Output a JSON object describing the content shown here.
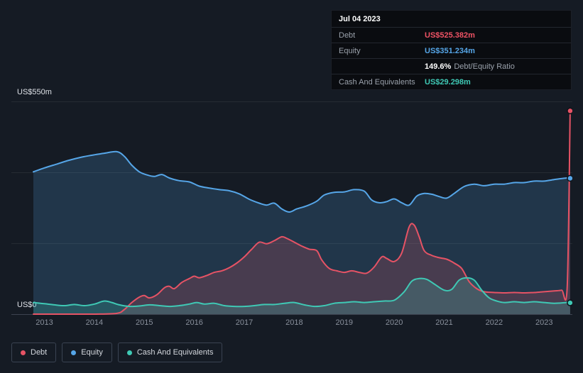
{
  "tooltip": {
    "date": "Jul 04 2023",
    "debt_label": "Debt",
    "debt_value": "US$525.382m",
    "equity_label": "Equity",
    "equity_value": "US$351.234m",
    "ratio_value": "149.6%",
    "ratio_label": "Debt/Equity Ratio",
    "cash_label": "Cash And Equivalents",
    "cash_value": "US$29.298m"
  },
  "axis": {
    "y_top_label": "US$550m",
    "y_bottom_label": "US$0",
    "x_ticks": [
      "2013",
      "2014",
      "2015",
      "2016",
      "2017",
      "2018",
      "2019",
      "2020",
      "2021",
      "2022",
      "2023"
    ]
  },
  "legend": [
    {
      "label": "Debt",
      "color": "#e65365"
    },
    {
      "label": "Equity",
      "color": "#56a6e8"
    },
    {
      "label": "Cash And Equivalents",
      "color": "#3fc9b5"
    }
  ],
  "colors": {
    "background": "#151b24",
    "grid": "rgba(255,255,255,0.07)",
    "axis_line": "#3c4350",
    "debt": "#e65365",
    "equity": "#56a6e8",
    "cash": "#3fc9b5"
  },
  "chart_data": {
    "type": "area",
    "as_of": "Jul 04 2023",
    "x_range": [
      2012.78,
      2023.55
    ],
    "ylim": [
      0,
      550
    ],
    "y_unit": "US$m",
    "final_values": {
      "debt_m": 525.382,
      "equity_m": 351.234,
      "cash_m": 29.298,
      "debt_equity_ratio_pct": 149.6
    },
    "series": [
      {
        "name": "Debt",
        "color": "#e65365",
        "fill": "rgba(230,83,101,0.20)",
        "points": [
          [
            2012.78,
            0
          ],
          [
            2013.5,
            0
          ],
          [
            2014.0,
            0
          ],
          [
            2014.45,
            2
          ],
          [
            2014.6,
            12
          ],
          [
            2014.75,
            30
          ],
          [
            2014.9,
            44
          ],
          [
            2015.0,
            48
          ],
          [
            2015.1,
            42
          ],
          [
            2015.25,
            50
          ],
          [
            2015.4,
            68
          ],
          [
            2015.5,
            72
          ],
          [
            2015.6,
            66
          ],
          [
            2015.75,
            82
          ],
          [
            2015.9,
            92
          ],
          [
            2016.0,
            98
          ],
          [
            2016.1,
            94
          ],
          [
            2016.25,
            100
          ],
          [
            2016.4,
            108
          ],
          [
            2016.55,
            112
          ],
          [
            2016.7,
            120
          ],
          [
            2016.85,
            132
          ],
          [
            2017.0,
            148
          ],
          [
            2017.15,
            168
          ],
          [
            2017.3,
            186
          ],
          [
            2017.45,
            182
          ],
          [
            2017.6,
            190
          ],
          [
            2017.75,
            200
          ],
          [
            2017.85,
            196
          ],
          [
            2018.0,
            186
          ],
          [
            2018.15,
            176
          ],
          [
            2018.3,
            168
          ],
          [
            2018.45,
            164
          ],
          [
            2018.55,
            140
          ],
          [
            2018.7,
            118
          ],
          [
            2018.85,
            112
          ],
          [
            2019.0,
            108
          ],
          [
            2019.15,
            112
          ],
          [
            2019.3,
            108
          ],
          [
            2019.45,
            106
          ],
          [
            2019.6,
            122
          ],
          [
            2019.75,
            148
          ],
          [
            2019.85,
            144
          ],
          [
            2020.0,
            136
          ],
          [
            2020.15,
            158
          ],
          [
            2020.3,
            226
          ],
          [
            2020.4,
            230
          ],
          [
            2020.5,
            200
          ],
          [
            2020.6,
            164
          ],
          [
            2020.75,
            152
          ],
          [
            2020.9,
            146
          ],
          [
            2021.05,
            142
          ],
          [
            2021.2,
            132
          ],
          [
            2021.35,
            118
          ],
          [
            2021.5,
            84
          ],
          [
            2021.65,
            66
          ],
          [
            2021.8,
            58
          ],
          [
            2022.0,
            56
          ],
          [
            2022.2,
            55
          ],
          [
            2022.4,
            56
          ],
          [
            2022.6,
            55
          ],
          [
            2022.8,
            56
          ],
          [
            2023.0,
            58
          ],
          [
            2023.2,
            60
          ],
          [
            2023.35,
            62
          ],
          [
            2023.46,
            68
          ],
          [
            2023.52,
            525.382
          ]
        ]
      },
      {
        "name": "Equity",
        "color": "#56a6e8",
        "fill": "rgba(86,166,232,0.20)",
        "points": [
          [
            2012.78,
            368
          ],
          [
            2013.0,
            378
          ],
          [
            2013.25,
            388
          ],
          [
            2013.5,
            398
          ],
          [
            2013.75,
            406
          ],
          [
            2014.0,
            412
          ],
          [
            2014.2,
            416
          ],
          [
            2014.45,
            420
          ],
          [
            2014.6,
            408
          ],
          [
            2014.75,
            385
          ],
          [
            2014.9,
            368
          ],
          [
            2015.05,
            360
          ],
          [
            2015.2,
            356
          ],
          [
            2015.35,
            361
          ],
          [
            2015.5,
            352
          ],
          [
            2015.7,
            345
          ],
          [
            2015.9,
            342
          ],
          [
            2016.1,
            331
          ],
          [
            2016.3,
            326
          ],
          [
            2016.5,
            322
          ],
          [
            2016.7,
            319
          ],
          [
            2016.9,
            311
          ],
          [
            2017.1,
            297
          ],
          [
            2017.3,
            287
          ],
          [
            2017.45,
            282
          ],
          [
            2017.6,
            287
          ],
          [
            2017.75,
            272
          ],
          [
            2017.9,
            264
          ],
          [
            2018.05,
            272
          ],
          [
            2018.25,
            280
          ],
          [
            2018.45,
            292
          ],
          [
            2018.6,
            308
          ],
          [
            2018.8,
            315
          ],
          [
            2019.0,
            316
          ],
          [
            2019.2,
            322
          ],
          [
            2019.4,
            318
          ],
          [
            2019.55,
            295
          ],
          [
            2019.7,
            288
          ],
          [
            2019.85,
            291
          ],
          [
            2020.0,
            298
          ],
          [
            2020.15,
            288
          ],
          [
            2020.3,
            282
          ],
          [
            2020.45,
            305
          ],
          [
            2020.6,
            312
          ],
          [
            2020.75,
            310
          ],
          [
            2020.9,
            304
          ],
          [
            2021.05,
            300
          ],
          [
            2021.2,
            312
          ],
          [
            2021.4,
            330
          ],
          [
            2021.6,
            336
          ],
          [
            2021.8,
            332
          ],
          [
            2022.0,
            336
          ],
          [
            2022.2,
            336
          ],
          [
            2022.4,
            340
          ],
          [
            2022.6,
            340
          ],
          [
            2022.8,
            344
          ],
          [
            2023.0,
            344
          ],
          [
            2023.2,
            348
          ],
          [
            2023.45,
            352
          ],
          [
            2023.52,
            351.234
          ]
        ]
      },
      {
        "name": "Cash And Equivalents",
        "color": "#3fc9b5",
        "fill": "rgba(63,201,181,0.22)",
        "points": [
          [
            2012.78,
            30
          ],
          [
            2013.0,
            27
          ],
          [
            2013.2,
            24
          ],
          [
            2013.4,
            22
          ],
          [
            2013.6,
            25
          ],
          [
            2013.8,
            22
          ],
          [
            2014.0,
            26
          ],
          [
            2014.2,
            34
          ],
          [
            2014.35,
            30
          ],
          [
            2014.5,
            24
          ],
          [
            2014.7,
            20
          ],
          [
            2014.9,
            21
          ],
          [
            2015.1,
            24
          ],
          [
            2015.3,
            22
          ],
          [
            2015.5,
            20
          ],
          [
            2015.7,
            22
          ],
          [
            2015.9,
            26
          ],
          [
            2016.05,
            30
          ],
          [
            2016.2,
            26
          ],
          [
            2016.4,
            28
          ],
          [
            2016.6,
            22
          ],
          [
            2016.8,
            20
          ],
          [
            2017.0,
            20
          ],
          [
            2017.2,
            22
          ],
          [
            2017.4,
            25
          ],
          [
            2017.6,
            25
          ],
          [
            2017.8,
            28
          ],
          [
            2018.0,
            30
          ],
          [
            2018.2,
            24
          ],
          [
            2018.4,
            20
          ],
          [
            2018.6,
            22
          ],
          [
            2018.8,
            28
          ],
          [
            2019.0,
            30
          ],
          [
            2019.2,
            32
          ],
          [
            2019.4,
            30
          ],
          [
            2019.6,
            32
          ],
          [
            2019.8,
            34
          ],
          [
            2020.0,
            36
          ],
          [
            2020.2,
            58
          ],
          [
            2020.35,
            85
          ],
          [
            2020.5,
            92
          ],
          [
            2020.65,
            90
          ],
          [
            2020.8,
            78
          ],
          [
            2021.0,
            62
          ],
          [
            2021.15,
            64
          ],
          [
            2021.3,
            88
          ],
          [
            2021.45,
            94
          ],
          [
            2021.6,
            88
          ],
          [
            2021.75,
            62
          ],
          [
            2021.9,
            42
          ],
          [
            2022.05,
            34
          ],
          [
            2022.2,
            30
          ],
          [
            2022.4,
            32
          ],
          [
            2022.6,
            30
          ],
          [
            2022.8,
            32
          ],
          [
            2023.0,
            30
          ],
          [
            2023.2,
            28
          ],
          [
            2023.45,
            30
          ],
          [
            2023.52,
            29.298
          ]
        ]
      }
    ]
  }
}
